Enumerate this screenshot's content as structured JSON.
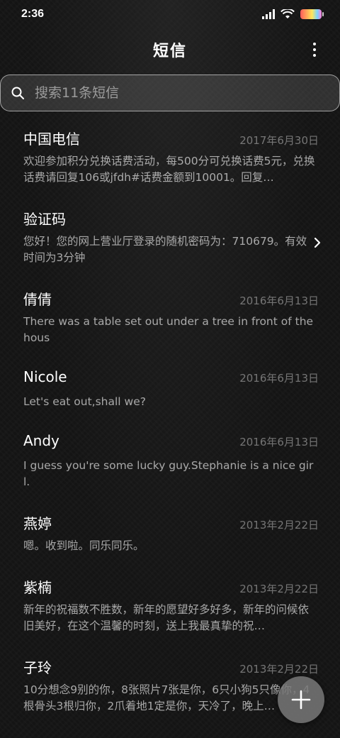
{
  "status_bar": {
    "time": "2:36",
    "icons": [
      "signal-icon",
      "wifi-icon",
      "battery-icon"
    ]
  },
  "header": {
    "title": "短信",
    "menu_icon": "more-vertical-icon"
  },
  "search": {
    "placeholder": "搜索11条短信",
    "value": "",
    "icon": "search-icon"
  },
  "messages": [
    {
      "name": "中国电信",
      "date": "2017年6月30日",
      "preview": "欢迎参加积分兑换话费活动，每500分可兑换话费5元，兑换话费请回复106或jfdh#话费金额到10001。回复…",
      "has_chevron": false
    },
    {
      "name": "验证码",
      "date": "",
      "preview": "您好！您的网上营业厅登录的随机密码为：710679。有效时间为3分钟",
      "has_chevron": true
    },
    {
      "name": "倩倩",
      "date": "2016年6月13日",
      "preview": "There was a table set out under a tree in front of the hous",
      "has_chevron": false
    },
    {
      "name": "Nicole",
      "date": "2016年6月13日",
      "preview": "Let's eat out,shall we?",
      "has_chevron": false
    },
    {
      "name": "Andy",
      "date": "2016年6月13日",
      "preview": "I guess you're some lucky guy.Stephanie is a nice girl.",
      "has_chevron": false
    },
    {
      "name": "燕婷",
      "date": "2013年2月22日",
      "preview": "嗯。收到啦。同乐同乐。",
      "has_chevron": false
    },
    {
      "name": "紫楠",
      "date": "2013年2月22日",
      "preview": "新年的祝福数不胜数，新年的愿望好多好多，新年的问候依旧美好，在这个温馨的时刻，送上我最真挚的祝…",
      "has_chevron": false
    },
    {
      "name": "子玲",
      "date": "2013年2月22日",
      "preview": "10分想念9别的你，8张照片7张是你，6只小狗5只像你，4根骨头3根归你，2爪着地1定是你，天冷了，晚上…",
      "has_chevron": false
    }
  ],
  "fab": {
    "icon": "plus-icon"
  },
  "colors": {
    "background": "#141414",
    "text_primary": "#ffffff",
    "text_secondary": "#9e9e9e",
    "fab": "#787878"
  }
}
